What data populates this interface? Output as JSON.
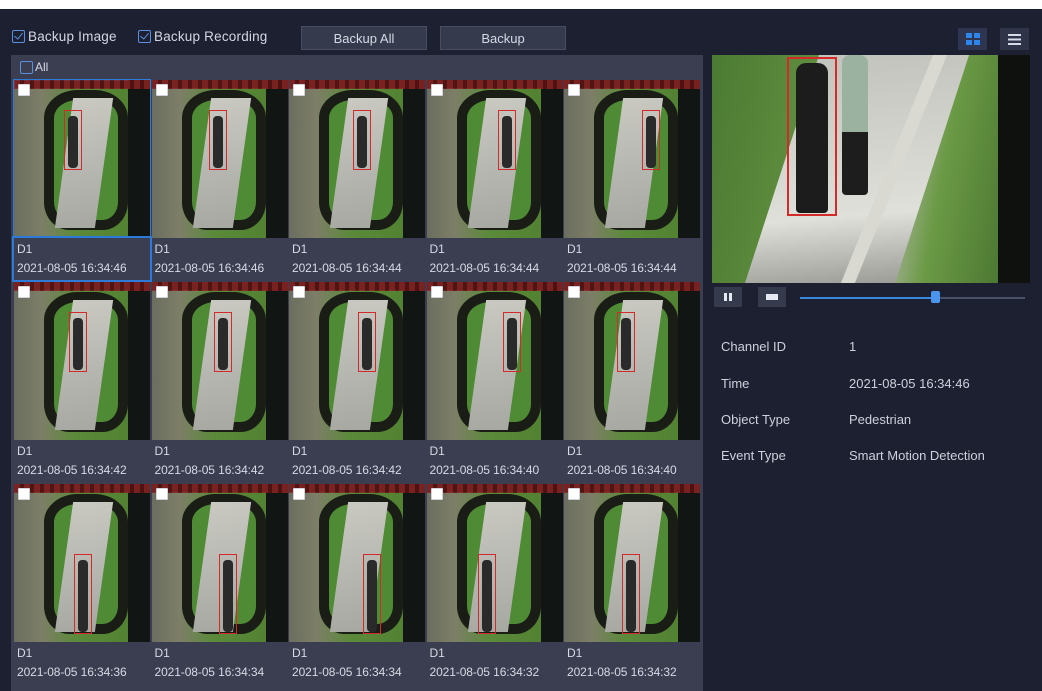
{
  "toolbar": {
    "backup_image": {
      "label": "Backup Image",
      "checked": true
    },
    "backup_recording": {
      "label": "Backup Recording",
      "checked": true
    },
    "backup_all_label": "Backup All",
    "backup_label": "Backup",
    "view_grid_icon": "grid-view-icon",
    "view_list_icon": "list-view-icon"
  },
  "select_all": {
    "label": "All",
    "checked": false
  },
  "results": [
    {
      "channel": "D1",
      "time": "2021-08-05 16:34:46",
      "selected": true
    },
    {
      "channel": "D1",
      "time": "2021-08-05 16:34:46",
      "selected": false
    },
    {
      "channel": "D1",
      "time": "2021-08-05 16:34:44",
      "selected": false
    },
    {
      "channel": "D1",
      "time": "2021-08-05 16:34:44",
      "selected": false
    },
    {
      "channel": "D1",
      "time": "2021-08-05 16:34:44",
      "selected": false
    },
    {
      "channel": "D1",
      "time": "2021-08-05 16:34:42",
      "selected": false
    },
    {
      "channel": "D1",
      "time": "2021-08-05 16:34:42",
      "selected": false
    },
    {
      "channel": "D1",
      "time": "2021-08-05 16:34:42",
      "selected": false
    },
    {
      "channel": "D1",
      "time": "2021-08-05 16:34:40",
      "selected": false
    },
    {
      "channel": "D1",
      "time": "2021-08-05 16:34:40",
      "selected": false
    },
    {
      "channel": "D1",
      "time": "2021-08-05 16:34:36",
      "selected": false
    },
    {
      "channel": "D1",
      "time": "2021-08-05 16:34:34",
      "selected": false
    },
    {
      "channel": "D1",
      "time": "2021-08-05 16:34:34",
      "selected": false
    },
    {
      "channel": "D1",
      "time": "2021-08-05 16:34:32",
      "selected": false
    },
    {
      "channel": "D1",
      "time": "2021-08-05 16:34:32",
      "selected": false
    }
  ],
  "player": {
    "pause_icon": "pause-icon",
    "stop_icon": "stop-icon",
    "progress": 0.6
  },
  "details": {
    "channel_id": {
      "label": "Channel ID",
      "value": "1"
    },
    "time": {
      "label": "Time",
      "value": "2021-08-05 16:34:46"
    },
    "object_type": {
      "label": "Object Type",
      "value": "Pedestrian"
    },
    "event_type": {
      "label": "Event Type",
      "value": "Smart Motion Detection"
    }
  },
  "colors": {
    "accent": "#2d7bd8",
    "background": "#1d2030",
    "panel": "#3a3e50",
    "detection_box": "#d42a2a"
  }
}
